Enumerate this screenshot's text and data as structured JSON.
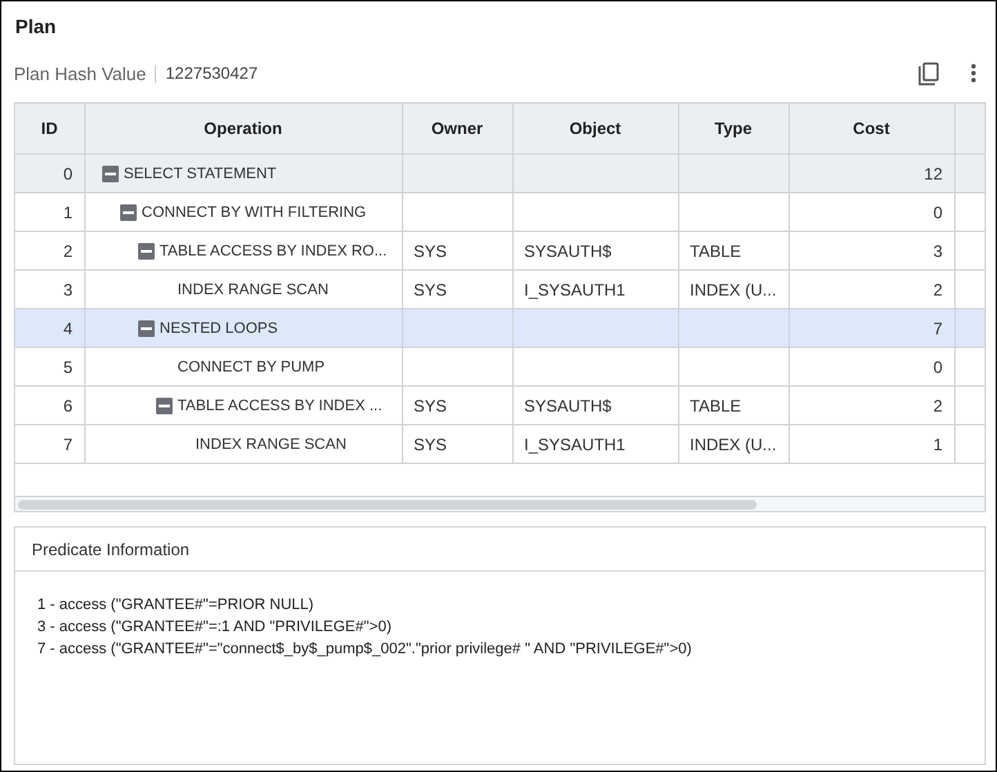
{
  "title": "Plan",
  "hash": {
    "label": "Plan Hash Value",
    "value": "1227530427"
  },
  "table": {
    "columns": [
      "ID",
      "Operation",
      "Owner",
      "Object",
      "Type",
      "Cost"
    ],
    "rows": [
      {
        "id": "0",
        "operation": "SELECT STATEMENT",
        "cost": "12",
        "selected": false,
        "hovered": true,
        "expanded": true,
        "children": [
          {
            "id": "1",
            "operation": "CONNECT BY WITH FILTERING",
            "cost": "0",
            "selected": false,
            "hovered": false,
            "expanded": true,
            "children": [
              {
                "id": "2",
                "operation": "TABLE ACCESS BY INDEX RO...",
                "owner": "SYS",
                "object": "SYSAUTH$",
                "type": "TABLE",
                "cost": "3",
                "selected": false,
                "hovered": false,
                "expanded": true,
                "children": [
                  {
                    "id": "3",
                    "operation": "INDEX RANGE SCAN",
                    "owner": "SYS",
                    "object": "I_SYSAUTH1",
                    "type": "INDEX (U...",
                    "cost": "2",
                    "selected": false,
                    "hovered": false
                  }
                ]
              },
              {
                "id": "4",
                "operation": "NESTED LOOPS",
                "cost": "7",
                "selected": true,
                "hovered": false,
                "expanded": true,
                "children": [
                  {
                    "id": "5",
                    "operation": "CONNECT BY PUMP",
                    "cost": "0",
                    "selected": false,
                    "hovered": false
                  },
                  {
                    "id": "6",
                    "operation": "TABLE ACCESS BY INDEX ...",
                    "owner": "SYS",
                    "object": "SYSAUTH$",
                    "type": "TABLE",
                    "cost": "2",
                    "selected": false,
                    "hovered": false,
                    "expanded": true,
                    "children": [
                      {
                        "id": "7",
                        "operation": "INDEX RANGE SCAN",
                        "owner": "SYS",
                        "object": "I_SYSAUTH1",
                        "type": "INDEX (U...",
                        "cost": "1",
                        "selected": false,
                        "hovered": false
                      }
                    ]
                  }
                ]
              }
            ]
          }
        ]
      }
    ]
  },
  "predicate": {
    "title": "Predicate Information",
    "lines": [
      "1 - access (\"GRANTEE#\"=PRIOR NULL)",
      "3 - access (\"GRANTEE#\"=:1 AND \"PRIVILEGE#\">0)",
      "7 - access (\"GRANTEE#\"=\"connect$_by$_pump$_002\".\"prior privilege# \" AND \"PRIVILEGE#\">0)"
    ]
  }
}
